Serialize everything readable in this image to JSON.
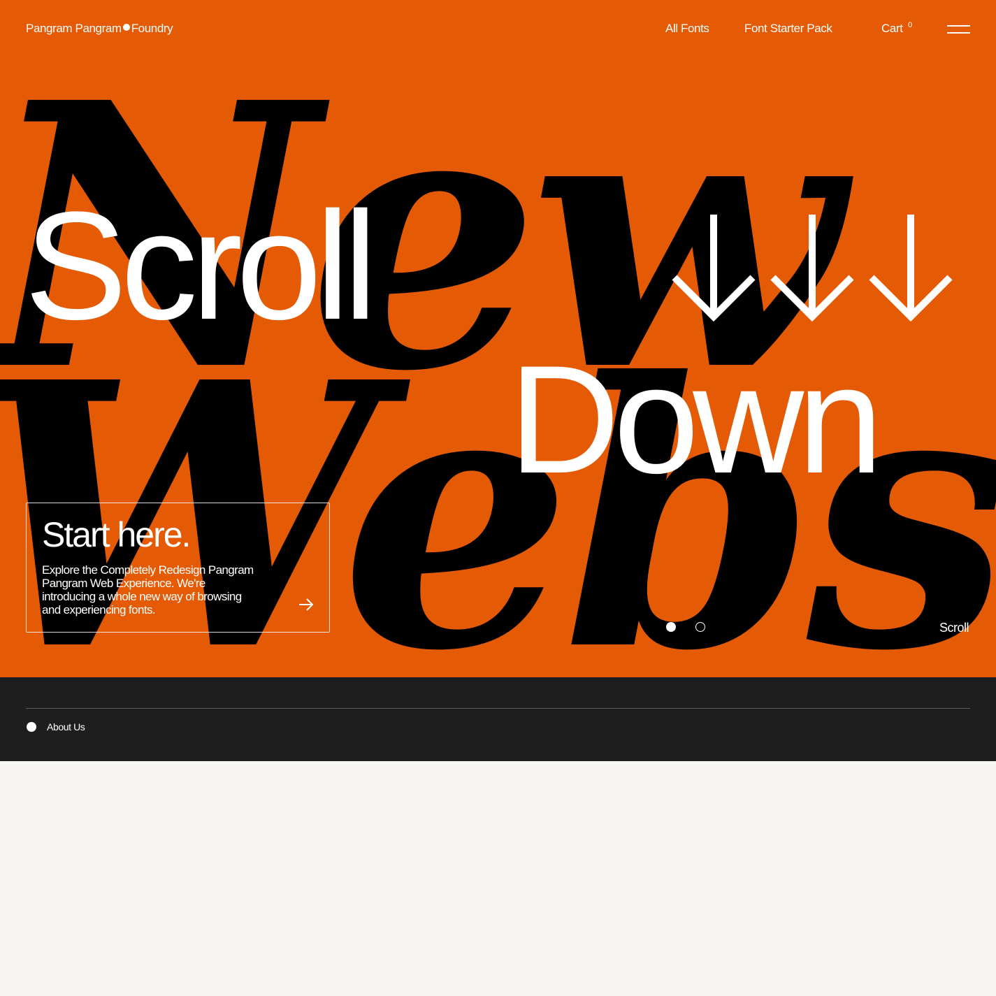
{
  "header": {
    "logo_part1": "Pangram Pangram",
    "logo_part2": "Foundry",
    "nav": {
      "all_fonts": "All Fonts",
      "starter_pack": "Font Starter Pack",
      "cart": "Cart",
      "cart_count": "0"
    },
    "menu_icon": "hamburger-menu-icon"
  },
  "hero": {
    "background_text_line1": "New",
    "background_text_line2": "Website",
    "headline_word1": "Scroll",
    "headline_word2": "Down",
    "arrow_icon": "arrow-down-icon",
    "card": {
      "title": "Start here.",
      "body": "Explore the Completely Redesign Pangram Pangram Web Experience. We're introducing a whole new way of browsing and experiencing fonts.",
      "arrow_icon": "arrow-right-icon"
    },
    "pager": {
      "count": 2,
      "active_index": 0
    },
    "scroll_label": "Scroll"
  },
  "section": {
    "about_label": "About Us"
  },
  "colors": {
    "hero_bg": "#e45a05",
    "dark_band": "#1e1e1f",
    "page_bg": "#f6f5f2",
    "text_light": "#ffffff"
  }
}
